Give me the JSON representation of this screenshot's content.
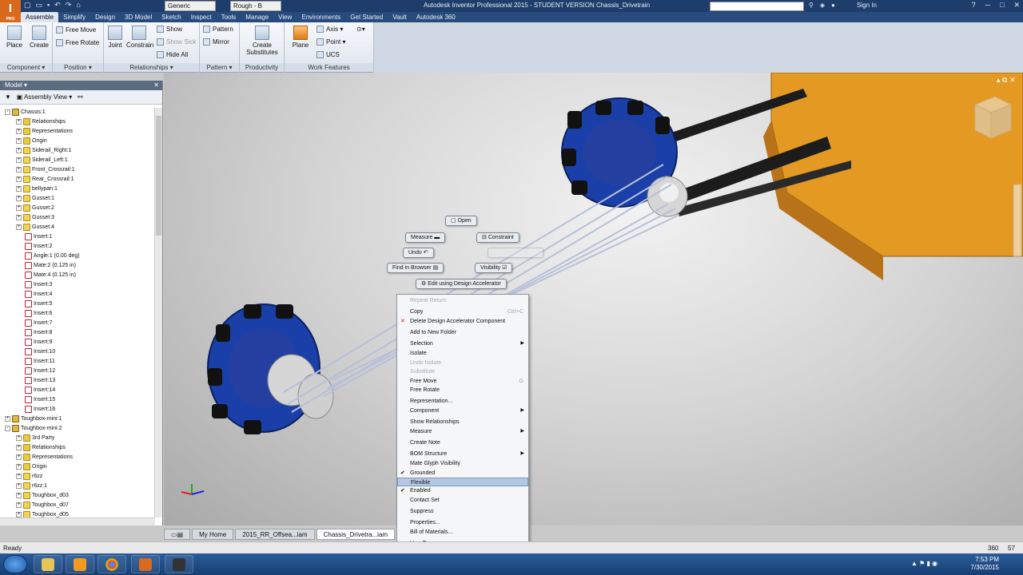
{
  "titlebar": {
    "title": "Autodesk Inventor Professional 2015 - STUDENT VERSION   Chassis_Drivetrain",
    "material": "Generic",
    "appearance": "Rough - B",
    "sign_in": "Sign In",
    "app_letter": "I",
    "app_badge": "PRO"
  },
  "tabs": [
    "Assemble",
    "Simplify",
    "Design",
    "3D Model",
    "Sketch",
    "Inspect",
    "Tools",
    "Manage",
    "View",
    "Environments",
    "Get Started",
    "Vault",
    "Autodesk 360"
  ],
  "ribbon": {
    "component": {
      "title": "Component",
      "place": "Place",
      "create": "Create"
    },
    "position": {
      "title": "Position",
      "free_move": "Free Move",
      "free_rotate": "Free Rotate"
    },
    "relationships": {
      "title": "Relationships",
      "joint": "Joint",
      "constrain": "Constrain",
      "show": "Show",
      "show_sick": "Show Sick",
      "hide_all": "Hide All"
    },
    "pattern": {
      "title": "Pattern",
      "pattern": "Pattern",
      "mirror": "Mirror"
    },
    "productivity": {
      "title": "Productivity",
      "create_substitutes": "Create Substitutes"
    },
    "work_features": {
      "title": "Work Features",
      "plane": "Plane",
      "axis": "Axis",
      "point": "Point",
      "ucs": "UCS"
    }
  },
  "browser": {
    "title": "Model",
    "view": "Assembly View",
    "nodes": [
      {
        "label": "Chassis:1",
        "depth": 0,
        "pm": "-",
        "icon": "asm"
      },
      {
        "label": "Relationships",
        "depth": 1,
        "pm": "+",
        "icon": "fold"
      },
      {
        "label": "Representations",
        "depth": 1,
        "pm": "+",
        "icon": "fold"
      },
      {
        "label": "Origin",
        "depth": 1,
        "pm": "+",
        "icon": "fold"
      },
      {
        "label": "Siderail_Right:1",
        "depth": 1,
        "pm": "+",
        "icon": "part"
      },
      {
        "label": "Siderail_Left:1",
        "depth": 1,
        "pm": "+",
        "icon": "part"
      },
      {
        "label": "Front_Crossrail:1",
        "depth": 1,
        "pm": "+",
        "icon": "part"
      },
      {
        "label": "Rear_Crossrail:1",
        "depth": 1,
        "pm": "+",
        "icon": "part"
      },
      {
        "label": "bellypan:1",
        "depth": 1,
        "pm": "+",
        "icon": "part"
      },
      {
        "label": "Gusset:1",
        "depth": 1,
        "pm": "+",
        "icon": "part"
      },
      {
        "label": "Gusset:2",
        "depth": 1,
        "pm": "+",
        "icon": "part"
      },
      {
        "label": "Gusset:3",
        "depth": 1,
        "pm": "+",
        "icon": "part"
      },
      {
        "label": "Gusset:4",
        "depth": 1,
        "pm": "+",
        "icon": "part"
      },
      {
        "label": "Insert:1",
        "depth": 1,
        "pm": "",
        "icon": "cons"
      },
      {
        "label": "Insert:2",
        "depth": 1,
        "pm": "",
        "icon": "cons"
      },
      {
        "label": "Angle:1 (0.00 deg)",
        "depth": 1,
        "pm": "",
        "icon": "cons"
      },
      {
        "label": "Mate:2 (0.125 in)",
        "depth": 1,
        "pm": "",
        "icon": "cons"
      },
      {
        "label": "Mate:4 (0.125 in)",
        "depth": 1,
        "pm": "",
        "icon": "cons"
      },
      {
        "label": "Insert:3",
        "depth": 1,
        "pm": "",
        "icon": "cons"
      },
      {
        "label": "Insert:4",
        "depth": 1,
        "pm": "",
        "icon": "cons"
      },
      {
        "label": "Insert:5",
        "depth": 1,
        "pm": "",
        "icon": "cons"
      },
      {
        "label": "Insert:6",
        "depth": 1,
        "pm": "",
        "icon": "cons"
      },
      {
        "label": "Insert:7",
        "depth": 1,
        "pm": "",
        "icon": "cons"
      },
      {
        "label": "Insert:8",
        "depth": 1,
        "pm": "",
        "icon": "cons"
      },
      {
        "label": "Insert:9",
        "depth": 1,
        "pm": "",
        "icon": "cons"
      },
      {
        "label": "Insert:10",
        "depth": 1,
        "pm": "",
        "icon": "cons"
      },
      {
        "label": "Insert:11",
        "depth": 1,
        "pm": "",
        "icon": "cons"
      },
      {
        "label": "Insert:12",
        "depth": 1,
        "pm": "",
        "icon": "cons"
      },
      {
        "label": "Insert:13",
        "depth": 1,
        "pm": "",
        "icon": "cons"
      },
      {
        "label": "Insert:14",
        "depth": 1,
        "pm": "",
        "icon": "cons"
      },
      {
        "label": "Insert:15",
        "depth": 1,
        "pm": "",
        "icon": "cons"
      },
      {
        "label": "Insert:16",
        "depth": 1,
        "pm": "",
        "icon": "cons"
      },
      {
        "label": "Toughbox-mini:1",
        "depth": 0,
        "pm": "+",
        "icon": "asm"
      },
      {
        "label": "Toughbox-mini:2",
        "depth": 0,
        "pm": "-",
        "icon": "asm"
      },
      {
        "label": "3rd Party",
        "depth": 1,
        "pm": "+",
        "icon": "fold"
      },
      {
        "label": "Relationships",
        "depth": 1,
        "pm": "+",
        "icon": "fold"
      },
      {
        "label": "Representations",
        "depth": 1,
        "pm": "+",
        "icon": "fold"
      },
      {
        "label": "Origin",
        "depth": 1,
        "pm": "+",
        "icon": "fold"
      },
      {
        "label": "r6zz",
        "depth": 1,
        "pm": "+",
        "icon": "part"
      },
      {
        "label": "r6zz:1",
        "depth": 1,
        "pm": "+",
        "icon": "part"
      },
      {
        "label": "Toughbox_d03",
        "depth": 1,
        "pm": "+",
        "icon": "part"
      },
      {
        "label": "Toughbox_d07",
        "depth": 1,
        "pm": "+",
        "icon": "part"
      },
      {
        "label": "Toughbox_d05",
        "depth": 1,
        "pm": "+",
        "icon": "part"
      }
    ]
  },
  "marking_menu": {
    "open": "Open",
    "measure": "Measure",
    "constraint": "Constraint",
    "undo": "Undo",
    "find_in_browser": "Find in Browser",
    "visibility": "Visibility",
    "edit_design_accelerator": "Edit using Design Accelerator"
  },
  "context_menu": {
    "items": [
      {
        "label": "Repeat Return",
        "disabled": true
      },
      {
        "label": "Copy",
        "shortcut": "Ctrl+C"
      },
      {
        "label": "Delete Design Accelerator Component",
        "mark": "✕"
      },
      {
        "label": "Add to New Folder"
      },
      {
        "label": "Selection",
        "submenu": true
      },
      {
        "label": "Isolate"
      },
      {
        "label": "Undo Isolate",
        "disabled": true
      },
      {
        "label": "Substitute",
        "disabled": true
      },
      {
        "label": "Free Move",
        "shortcut": "G"
      },
      {
        "label": "Free Rotate"
      },
      {
        "label": "Representation..."
      },
      {
        "label": "Component",
        "submenu": true
      },
      {
        "label": "Show Relationships"
      },
      {
        "label": "Measure",
        "submenu": true
      },
      {
        "label": "Create Note"
      },
      {
        "label": "BOM Structure",
        "submenu": true
      },
      {
        "label": "Mate Glyph Visibility"
      },
      {
        "label": "Grounded",
        "mark": "✔"
      },
      {
        "label": "Flexible",
        "highlight": true
      },
      {
        "label": "Enabled",
        "mark": "✔"
      },
      {
        "label": "Contact Set"
      },
      {
        "label": "Suppress"
      },
      {
        "label": "Properties..."
      },
      {
        "label": "Bill of Materials..."
      },
      {
        "label": "How To..."
      }
    ]
  },
  "doc_tabs": [
    "My Home",
    "2015_RR_Offsea...iam",
    "Chassis_Drivetra...iam"
  ],
  "status": {
    "left": "Ready",
    "count1": "360",
    "count2": "57"
  },
  "taskbar": {
    "time": "7:53 PM",
    "date": "7/30/2015"
  },
  "colors": {
    "accent": "#d9691c",
    "titlebar": "#1e3d6b",
    "wheel_blue": "#1a3fa8",
    "chassis_orange": "#e49a22"
  }
}
